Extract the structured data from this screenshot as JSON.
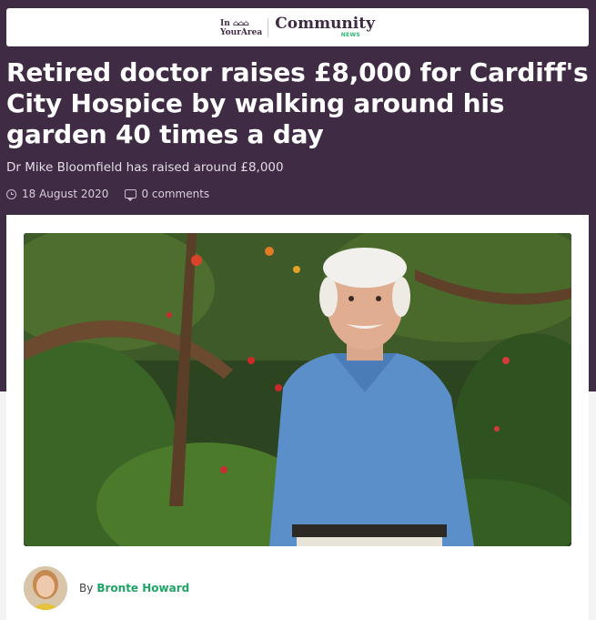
{
  "brand": {
    "in_your_area_line1": "In",
    "in_your_area_line2": "YourArea",
    "section_name": "Community",
    "section_sub": "NEWS",
    "house_icons": "house-icons",
    "brand_color": "#3f2b44",
    "accent_color": "#2bb673"
  },
  "article": {
    "headline": "Retired doctor raises £8,000 for Cardiff's City Hospice by walking around his garden 40 times a day",
    "standfirst": "Dr Mike Bloomfield has raised around £8,000",
    "date": "18 August 2020",
    "comments": "0 comments",
    "date_icon": "clock-icon",
    "comments_icon": "comment-icon"
  },
  "byline": {
    "prefix": "By",
    "author": "Bronte Howard",
    "avatar_icon": "author-avatar"
  }
}
